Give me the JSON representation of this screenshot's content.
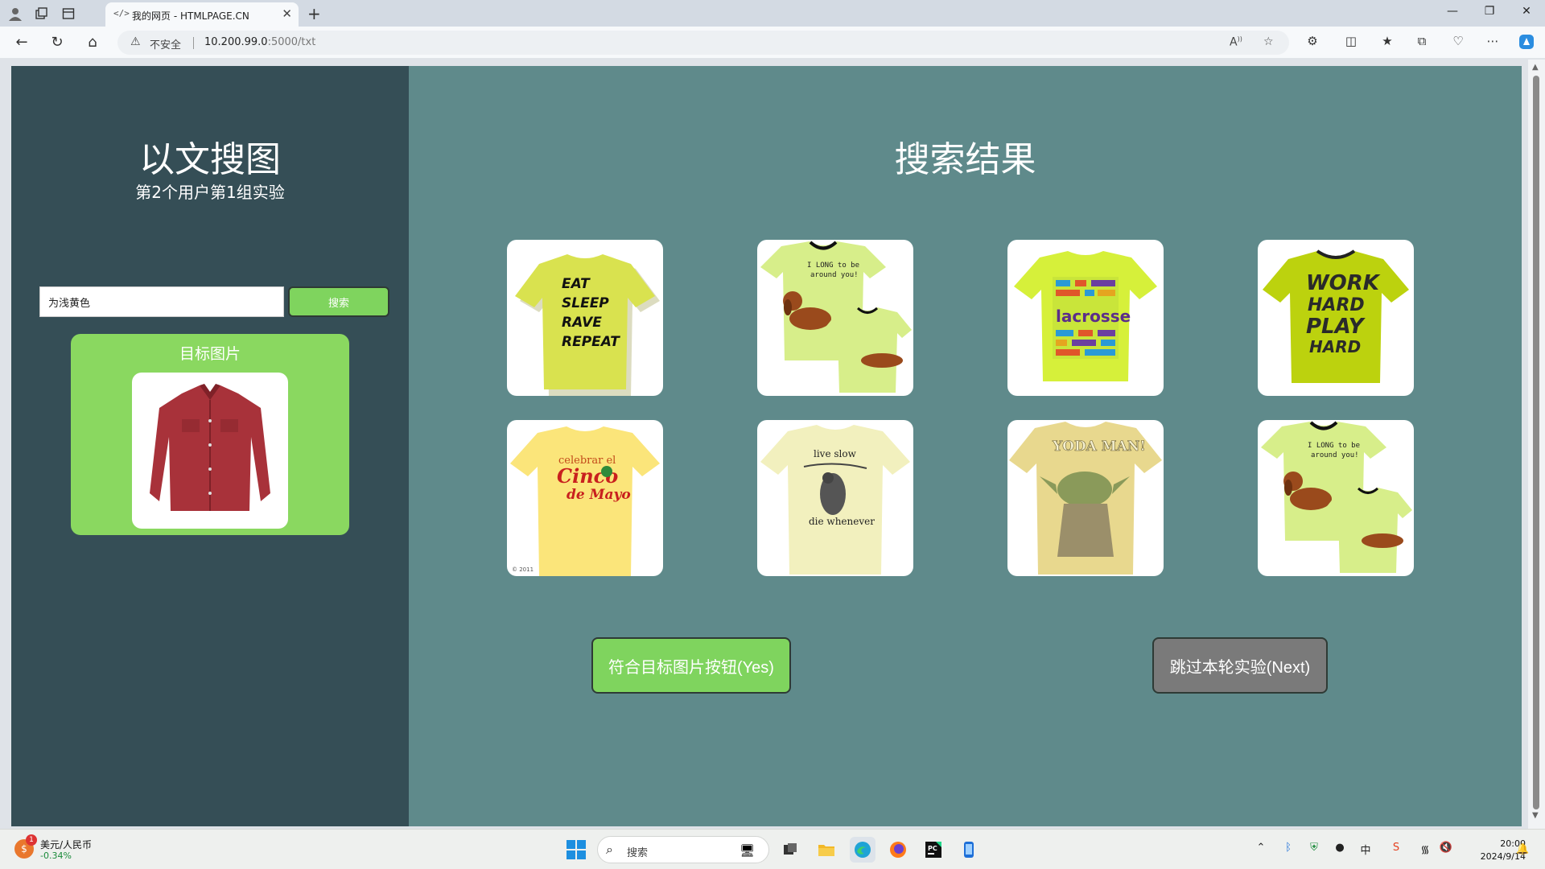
{
  "browser": {
    "tab_title": "我的网页 - HTMLPAGE.CN",
    "tab_favicon": "</>",
    "insecure_label": "不安全",
    "url_host": "10.200.99.0",
    "url_rest": ":5000/txt"
  },
  "page": {
    "left_panel": {
      "title": "以文搜图",
      "subtitle": "第2个用户第1组实验",
      "search_value": "为浅黄色",
      "search_button": "搜索",
      "target_label": "目标图片",
      "target_image": "red-button-up-shirt"
    },
    "right_panel": {
      "title": "搜索结果",
      "results": [
        {
          "image": "yellow-tshirt-eat-sleep-rave-repeat",
          "texts": [
            "EAT",
            "SLEEP",
            "RAVE",
            "REPEAT"
          ]
        },
        {
          "image": "lime-tshirts-dachshund-i-long-to-be-around-you",
          "texts": [
            "I LONG to be",
            "around you!"
          ]
        },
        {
          "image": "lime-tshirt-lacrosse-word-cloud",
          "texts": [
            "lacrosse"
          ]
        },
        {
          "image": "lime-tshirt-work-hard-play-hard",
          "texts": [
            "WORK",
            "HARD",
            "PLAY",
            "HARD"
          ]
        },
        {
          "image": "yellow-tshirt-celebrar-cinco-de-mayo",
          "texts": [
            "celebrar el",
            "Cinco",
            "de Mayo",
            "© 2011"
          ]
        },
        {
          "image": "cream-tshirt-sloth-live-slow-die-whenever",
          "texts": [
            "live slow",
            "die whenever"
          ]
        },
        {
          "image": "tan-tshirt-yoda-man",
          "texts": [
            "YODA MAN!"
          ]
        },
        {
          "image": "lime-tshirts-dachshund-i-long-to-be-around-you",
          "texts": [
            "I LONG to be",
            "around you!"
          ]
        }
      ],
      "yes_button": "符合目标图片按钮(Yes)",
      "next_button": "跳过本轮实验(Next)"
    }
  },
  "taskbar": {
    "widget_pair": "美元/人民币",
    "widget_change": "-0.34%",
    "widget_badge": "1",
    "search_placeholder": "搜索",
    "ime": "中",
    "time": "20:00",
    "date": "2024/9/14"
  },
  "colors": {
    "left_panel": "#354e56",
    "right_panel": "#5f8a8b",
    "accent_green": "#7fd45e",
    "card_green": "#8ad860",
    "next_gray": "#7a7a7a"
  }
}
